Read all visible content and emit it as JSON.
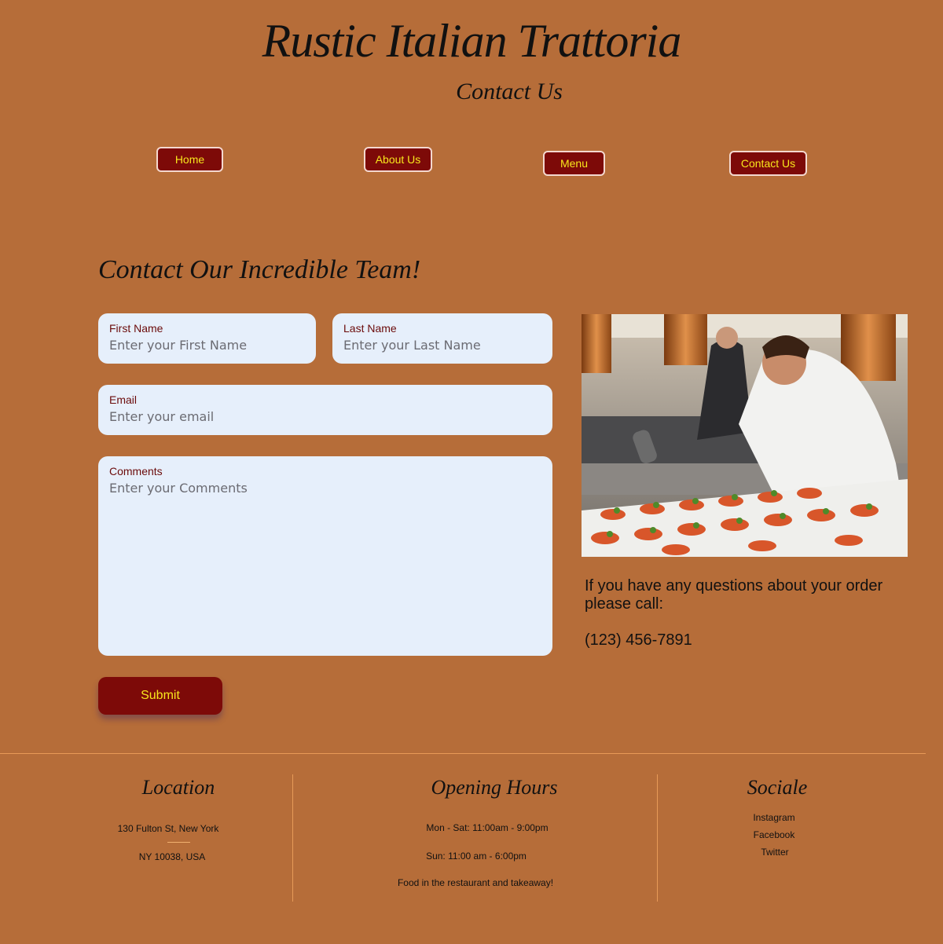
{
  "header": {
    "title": "Rustic Italian Trattoria",
    "subtitle": "Contact Us"
  },
  "nav": {
    "home": "Home",
    "about": "About Us",
    "menu": "Menu",
    "contact": "Contact Us"
  },
  "form": {
    "heading": "Contact Our Incredible Team!",
    "first_name": {
      "label": "First Name",
      "placeholder": "Enter your First Name",
      "value": ""
    },
    "last_name": {
      "label": "Last Name",
      "placeholder": "Enter your Last Name",
      "value": ""
    },
    "email": {
      "label": "Email",
      "placeholder": "Enter your email",
      "value": ""
    },
    "comments": {
      "label": "Comments",
      "placeholder": "Enter your Comments",
      "value": ""
    },
    "submit_label": "Submit"
  },
  "info": {
    "text": "If you have any questions about your order please call:",
    "phone": "(123) 456-7891"
  },
  "footer": {
    "location": {
      "heading": "Location",
      "line1": "130 Fulton St,   New York",
      "line2": "NY 10038, USA"
    },
    "hours": {
      "heading": "Opening Hours",
      "line1": "Mon - Sat: 11:00am - 9:00pm",
      "line2": "Sun: 11:00 am - 6:00pm",
      "line3": "Food in the restaurant and takeaway!"
    },
    "social": {
      "heading": "Sociale",
      "links": [
        "Instagram",
        "Facebook",
        "Twitter"
      ]
    }
  },
  "colors": {
    "background": "#b66d39",
    "button": "#7d0a08",
    "button_text": "#f8e71c",
    "field_bg": "#e6effb",
    "label": "#6b0b0b",
    "divider": "#e79a58"
  },
  "icons": {
    "photo": "chef-plating-photo"
  }
}
